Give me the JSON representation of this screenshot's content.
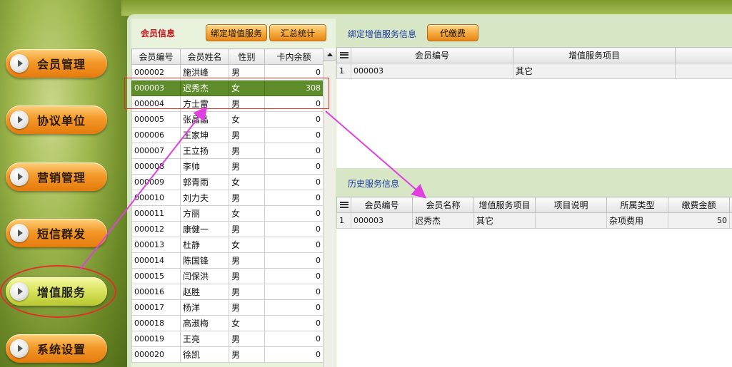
{
  "nav": {
    "items": [
      {
        "label": "会员管理",
        "active": false
      },
      {
        "label": "协议单位",
        "active": false
      },
      {
        "label": "营销管理",
        "active": false
      },
      {
        "label": "短信群发",
        "active": false
      },
      {
        "label": "增值服务",
        "active": true
      },
      {
        "label": "系统设置",
        "active": false
      }
    ]
  },
  "member_panel": {
    "title": "会员信息",
    "bind_button": "绑定增值服务",
    "summary_button": "汇总统计",
    "columns": [
      "会员编号",
      "会员姓名",
      "性别",
      "卡内余额"
    ],
    "rows": [
      [
        "000002",
        "施洪峰",
        "男",
        "0"
      ],
      [
        "000003",
        "迟秀杰",
        "女",
        "308"
      ],
      [
        "000004",
        "方士雷",
        "男",
        "0"
      ],
      [
        "000005",
        "张晶晶",
        "女",
        "0"
      ],
      [
        "000006",
        "王家坤",
        "男",
        "0"
      ],
      [
        "000007",
        "王立扬",
        "男",
        "0"
      ],
      [
        "000008",
        "李帅",
        "男",
        "0"
      ],
      [
        "000009",
        "郭青雨",
        "女",
        "0"
      ],
      [
        "000010",
        "刘力夫",
        "男",
        "0"
      ],
      [
        "000011",
        "方丽",
        "女",
        "0"
      ],
      [
        "000012",
        "康健一",
        "男",
        "0"
      ],
      [
        "000013",
        "杜静",
        "女",
        "0"
      ],
      [
        "000014",
        "陈国锋",
        "男",
        "0"
      ],
      [
        "000015",
        "闫保洪",
        "男",
        "0"
      ],
      [
        "000016",
        "赵胜",
        "男",
        "0"
      ],
      [
        "000017",
        "杨洋",
        "男",
        "0"
      ],
      [
        "000018",
        "高淑梅",
        "女",
        "0"
      ],
      [
        "000019",
        "王亮",
        "男",
        "0"
      ],
      [
        "000020",
        "徐凯",
        "男",
        "0"
      ]
    ],
    "selected_row": 1
  },
  "bound_panel": {
    "title": "绑定增值服务信息",
    "pay_button": "代缴费",
    "columns": [
      "会员编号",
      "增值服务项目"
    ],
    "rows": [
      [
        "1",
        "000003",
        "其它"
      ]
    ]
  },
  "history_panel": {
    "title": "历史服务信息",
    "columns": [
      "会员编号",
      "会员名称",
      "增值服务项目",
      "项目说明",
      "所属类型",
      "缴费金额"
    ],
    "rows": [
      [
        "1",
        "000003",
        "迟秀杰",
        "其它",
        "",
        "杂项费用",
        "50"
      ]
    ]
  },
  "colors": {
    "accent_red": "#c8161d",
    "title_blue": "#1a3aa6",
    "selected_row": "#5f8c2a",
    "annotation_arrow": "#e040e0",
    "annotation_outline": "#e0302a"
  }
}
